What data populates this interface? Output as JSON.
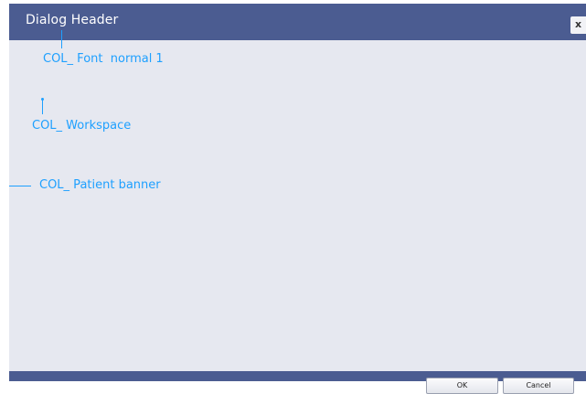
{
  "dialog": {
    "title": "Dialog Header",
    "close_label": "x",
    "ok_label": "OK",
    "cancel_label": "Cancel"
  },
  "annotations": {
    "font_normal": "COL_ Font  normal 1",
    "workspace": "COL_ Workspace",
    "patient_banner": "COL_ Patient banner"
  },
  "colors": {
    "header": "#4b5c91",
    "workspace": "#e6e8f0",
    "annotation": "#1ea0ff"
  }
}
